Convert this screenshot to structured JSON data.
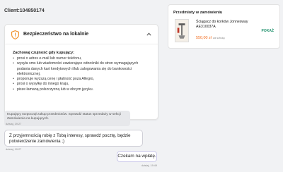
{
  "client": {
    "label": "Client:104850174"
  },
  "security": {
    "title": "Bezpieczeństwo na lokalnie",
    "heading": "Zachowaj czujność gdy kupujący:",
    "items": [
      "prosi o adres e-mail lub numer telefonu,",
      "wysyła sms lub wiadomości zawierające odnośniki do stron wymagających podania danych kart kredytowych i/lub zalogowania się do bankowości elektronicznej,",
      "proponuje wyższą cenę i płatność poza Allegro,",
      "prosi o wysyłkę do innego kraju,",
      "pisze łamaną polszczyzną lub w obcym języku."
    ]
  },
  "order": {
    "title": "Przedmioty w zamówieniu",
    "product_name": "Ściągacz do korków Jonnesway AE310037A",
    "price": "550,00 zł",
    "price_unit": "za sztukę",
    "show_label": "POKAŻ"
  },
  "chat": {
    "system_message": "Kupujący rozpoczął zakup przedmiotów. Sprawdź status sprzedaży w sekcji Zamówienia na kupujących.",
    "system_time": "dzisiaj, 19:27",
    "incoming_message": "Z przyjemnością robię z Tobą interesy, sprawdź pocztę, będzie potwierdzenie zamówienia ;)",
    "incoming_time": "dzisiaj, 19:27",
    "outgoing_message": "Czekam na wpłatę.",
    "outgoing_time": "dzisiaj, 19:49"
  },
  "colors": {
    "shield": "#f08a1d",
    "price": "#f36b1c",
    "show_link": "#23936f",
    "outgoing_border": "#c8c5e8"
  },
  "icons": {
    "shield": "shield-icon",
    "collapse": "chevron-up-icon"
  }
}
